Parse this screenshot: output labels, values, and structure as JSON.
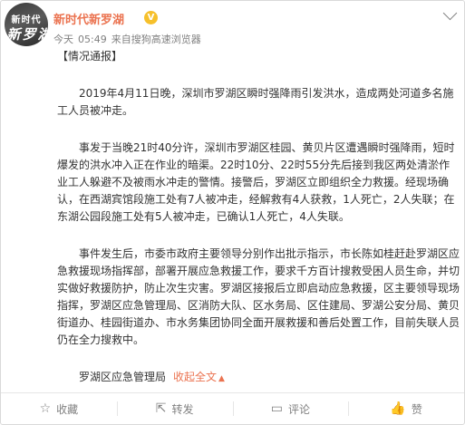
{
  "account": {
    "avatar_text_top": "新时代",
    "avatar_text_bottom": "新罗湖",
    "name": "新时代新罗湖",
    "verified_badge": "V",
    "menu_icon": "chevron-down-icon"
  },
  "meta": {
    "day": "今天",
    "time": "05:49",
    "source_prefix": "来自",
    "source": "搜狗高速浏览器"
  },
  "post": {
    "tag": "【情况通报】",
    "paragraphs": [
      "2019年4月11日晚，深圳市罗湖区瞬时强降雨引发洪水，造成两处河道多名施工人员被冲走。",
      "事发于当晚21时40分许，深圳市罗湖区桂园、黄贝片区遭遇瞬时强降雨，短时爆发的洪水冲入正在作业的暗渠。22时10分、22时55分先后接到我区两处清淤作业工人躲避不及被雨水冲走的警情。接警后，罗湖区立即组织全力救援。经现场确认，在西湖宾馆段施工处有7人被冲走，经解救有4人获救，1人死亡，2人失联；在东湖公园段施工处有5人被冲走，已确认1人死亡，4人失联。",
      "事件发生后，市委市政府主要领导分别作出批示指示，市长陈如桂赶赴罗湖区应急救援现场指挥部，部署开展应急救援工作，要求千方百计搜救受困人员生命，并切实做好救援防护，防止次生灾害。罗湖区接报后立即启动应急救援，区主要领导现场指挥，罗湖区应急管理局、区消防大队、区水务局、区住建局、罗湖公安分局、黄贝街道办、桂园街道办、市水务集团协同全面开展救援和善后处置工作，目前失联人员仍在全力搜救中。"
    ],
    "signature": "罗湖区应急管理局",
    "collapse_label": "收起全文",
    "collapse_arrow": "▲"
  },
  "actions": [
    {
      "icon": "star-icon",
      "glyph": "☆",
      "label": "收藏"
    },
    {
      "icon": "share-icon",
      "glyph": "⇱",
      "label": "转发"
    },
    {
      "icon": "comment-icon",
      "glyph": "▭",
      "label": "评论"
    },
    {
      "icon": "like-icon",
      "glyph": "👍",
      "label": "赞"
    }
  ]
}
